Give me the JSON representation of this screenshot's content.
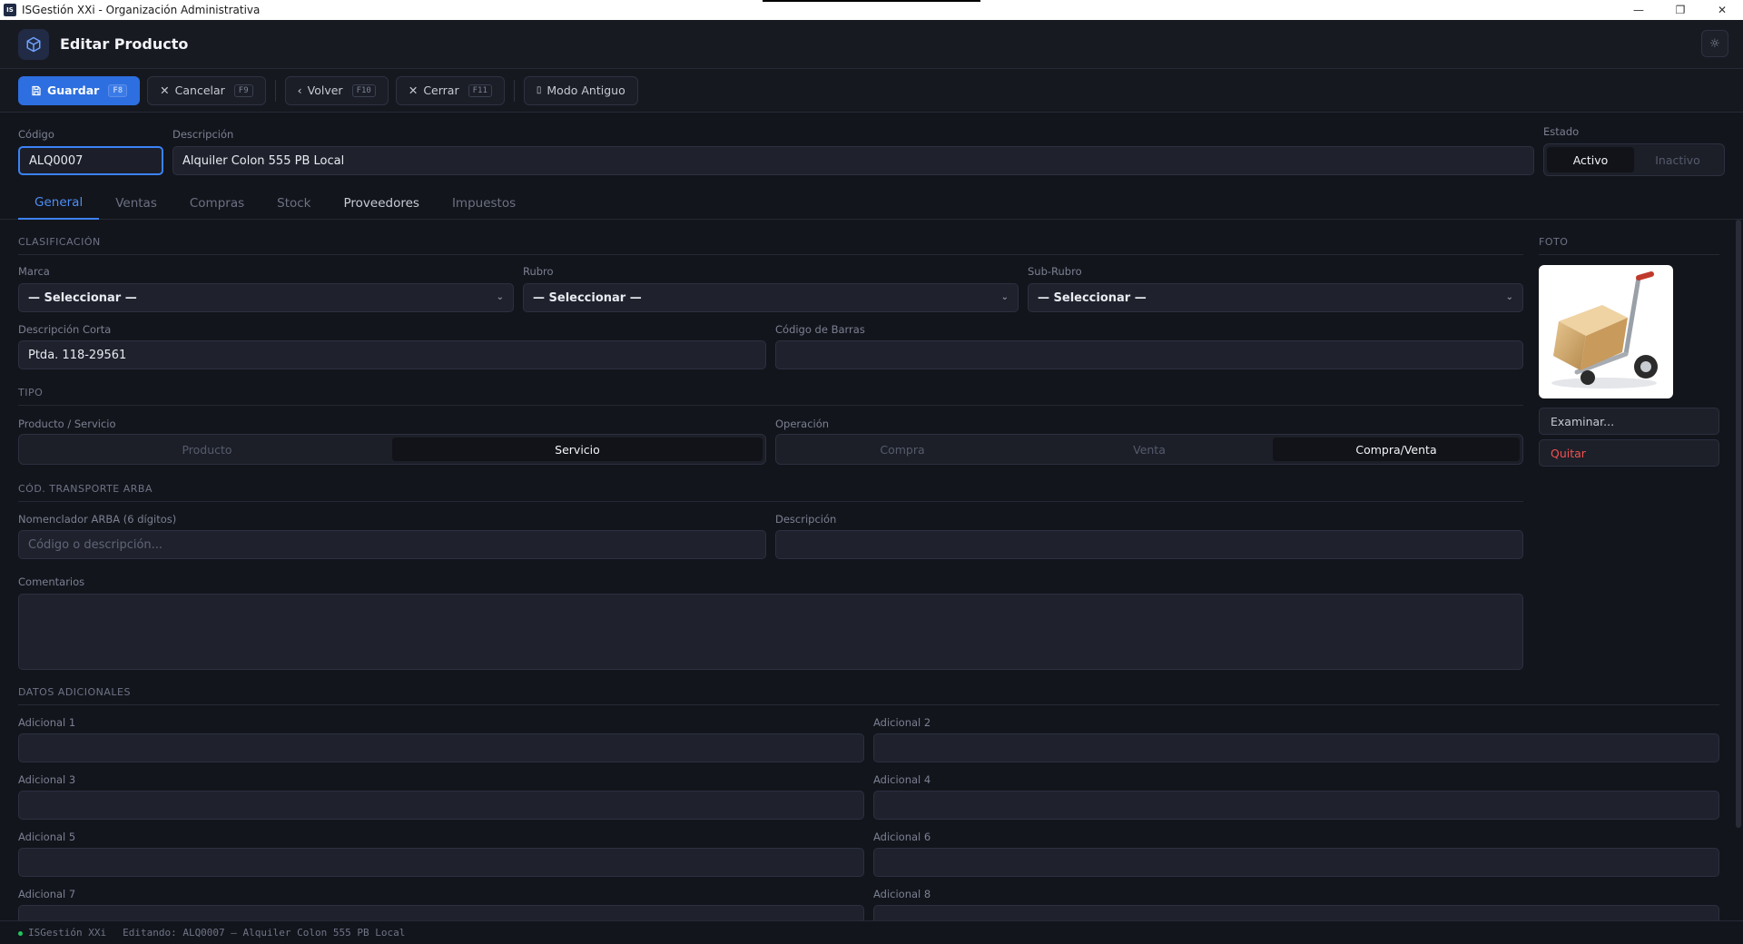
{
  "window": {
    "title": "ISGestión XXi - Organización Administrativa",
    "app_icon_text": "IS"
  },
  "header": {
    "title": "Editar Producto"
  },
  "toolbar": {
    "save": {
      "label": "Guardar",
      "key": "F8"
    },
    "cancel": {
      "label": "Cancelar",
      "key": "F9"
    },
    "back": {
      "label": "Volver",
      "key": "F10"
    },
    "close": {
      "label": "Cerrar",
      "key": "F11"
    },
    "legacy": {
      "label": "Modo Antiguo"
    }
  },
  "top": {
    "code_label": "Código",
    "code_value": "ALQ0007",
    "desc_label": "Descripción",
    "desc_value": "Alquiler Colon 555 PB Local",
    "state_label": "Estado",
    "state_active": "Activo",
    "state_inactive": "Inactivo"
  },
  "tabs": [
    "General",
    "Ventas",
    "Compras",
    "Stock",
    "Proveedores",
    "Impuestos"
  ],
  "clasificacion": {
    "title": "CLASIFICACIÓN",
    "marca_label": "Marca",
    "marca_value": "— Seleccionar —",
    "rubro_label": "Rubro",
    "rubro_value": "— Seleccionar —",
    "subrubro_label": "Sub-Rubro",
    "subrubro_value": "— Seleccionar —",
    "desc_corta_label": "Descripción Corta",
    "desc_corta_value": "Ptda. 118-29561",
    "barras_label": "Código de Barras",
    "barras_value": ""
  },
  "tipo": {
    "title": "TIPO",
    "ps_label": "Producto / Servicio",
    "opt_producto": "Producto",
    "opt_servicio": "Servicio",
    "op_label": "Operación",
    "opt_compra": "Compra",
    "opt_venta": "Venta",
    "opt_compraventa": "Compra/Venta"
  },
  "arba": {
    "title": "CÓD. TRANSPORTE ARBA",
    "nom_label": "Nomenclador ARBA (6 dígitos)",
    "nom_placeholder": "Código o descripción...",
    "desc_label": "Descripción",
    "desc_value": ""
  },
  "comentarios": {
    "label": "Comentarios",
    "value": ""
  },
  "adicionales": {
    "title": "DATOS ADICIONALES",
    "labels": [
      "Adicional 1",
      "Adicional 2",
      "Adicional 3",
      "Adicional 4",
      "Adicional 5",
      "Adicional 6",
      "Adicional 7",
      "Adicional 8"
    ]
  },
  "foto": {
    "title": "FOTO",
    "browse": "Examinar...",
    "remove": "Quitar"
  },
  "status": {
    "app": "ISGestión XXi",
    "editing": "Editando: ALQ0007 — Alquiler Colon 555 PB Local"
  },
  "colors": {
    "accent": "#3b82f6",
    "danger": "#f05252",
    "background": "#13151c"
  }
}
